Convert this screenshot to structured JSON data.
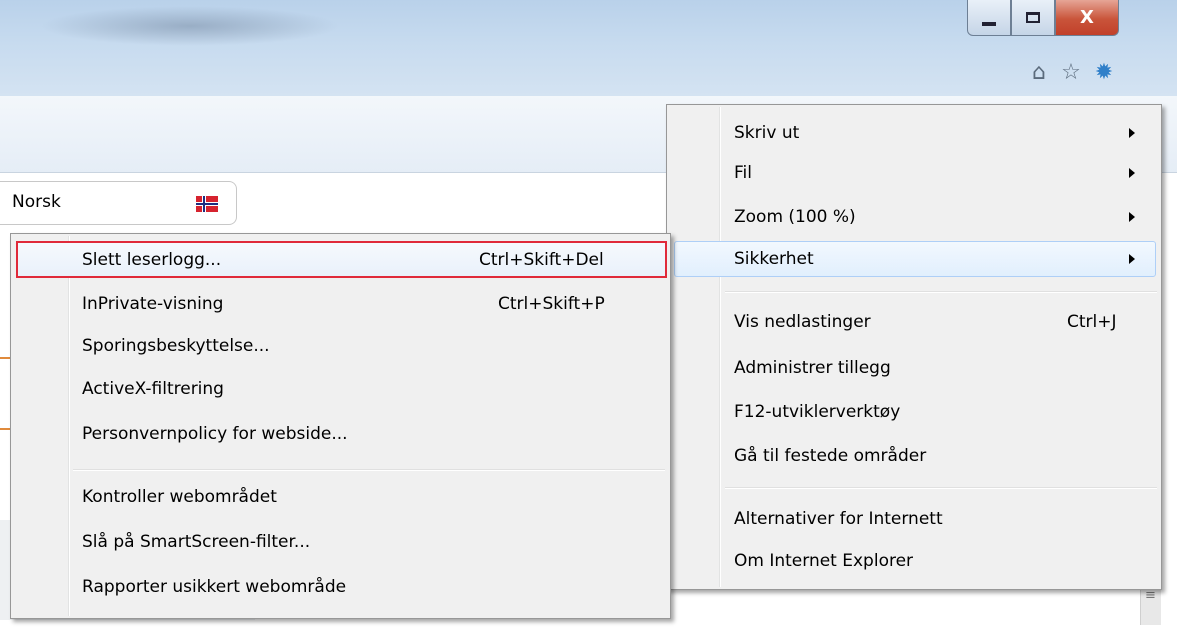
{
  "window": {
    "minimize_icon": "minimize-icon",
    "maximize_icon": "maximize-icon",
    "close_glyph": "X"
  },
  "toolbar": {
    "home_glyph": "⌂",
    "favorites_glyph": "☆",
    "tools_glyph": "✹"
  },
  "page": {
    "language_label": "Norsk",
    "language_flag": "norway-flag-icon"
  },
  "colors": {
    "highlight_border": "#e02a3a",
    "hover_blue": "#aecff7",
    "gear_blue": "#2f7fc9"
  },
  "tools_menu": {
    "items": [
      {
        "label": "Skriv ut",
        "submenu": true
      },
      {
        "label": "Fil",
        "submenu": true
      },
      {
        "label": "Zoom (100 %)",
        "submenu": true
      },
      {
        "label": "Sikkerhet",
        "submenu": true,
        "highlighted": true
      },
      {
        "label": "Vis nedlastinger",
        "shortcut": "Ctrl+J"
      },
      {
        "label": "Administrer tillegg"
      },
      {
        "label": "F12-utviklerverktøy"
      },
      {
        "label": "Gå til festede områder"
      },
      {
        "label": "Alternativer for Internett"
      },
      {
        "label": "Om Internet Explorer"
      }
    ]
  },
  "safety_menu": {
    "items": [
      {
        "label": "Slett leserlogg...",
        "shortcut": "Ctrl+Skift+Del",
        "highlighted": true
      },
      {
        "label": "InPrivate-visning",
        "shortcut": "Ctrl+Skift+P"
      },
      {
        "label": "Sporingsbeskyttelse..."
      },
      {
        "label": "ActiveX-filtrering"
      },
      {
        "label": "Personvernpolicy for webside..."
      },
      {
        "label": "Kontroller webområdet"
      },
      {
        "label": "Slå på SmartScreen-filter..."
      },
      {
        "label": "Rapporter usikkert webområde"
      }
    ]
  }
}
